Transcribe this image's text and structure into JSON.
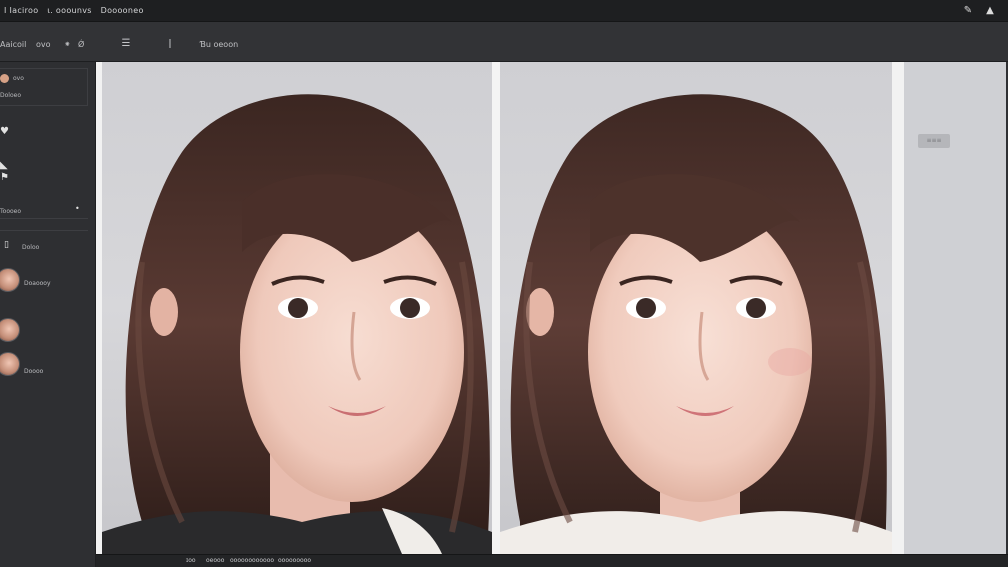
{
  "app": {
    "title_parts": [
      "Ⅰ Iaciroo",
      "ι. ooounvs",
      "Dooooneo"
    ],
    "window_icons": [
      "brush-icon",
      "triangle-icon"
    ]
  },
  "toolbar": {
    "items": [
      "Aaicoil",
      "ovo",
      "⁕",
      "Ǿ"
    ],
    "menu_icon": "list-icon",
    "text_cursor_icon": "text-cursor-icon",
    "label": "Ɓu oeoon"
  },
  "sidebar": {
    "box_items": [
      {
        "label": "ovo",
        "icon": "face-dot-icon"
      },
      {
        "label": "Doloeo"
      }
    ],
    "tools": [
      "heart-icon",
      "triangle-icon",
      "flag-icon"
    ],
    "section_label": "Toooeo",
    "section_toggle": "•",
    "sub_label": "Doloo",
    "sub_icon": "phone-icon",
    "faces": [
      {
        "label": "Doaoooy"
      },
      {
        "label": ""
      },
      {
        "label": "Doooo"
      }
    ]
  },
  "right_panel": {
    "chip_label": "≡≡≡"
  },
  "status": {
    "parts": [
      "ɪoo",
      "oeooo",
      "oooooooooooo",
      "ooooooooo"
    ]
  },
  "colors": {
    "app_bg": "#2b2c2e",
    "topbar_bg": "#1e1f21",
    "toolbar_bg": "#323336",
    "sidebar_bg": "#2e2f32",
    "canvas_bg": "#cfcfd3",
    "hair": "#4a3029",
    "skin": "#f2d2c6"
  }
}
